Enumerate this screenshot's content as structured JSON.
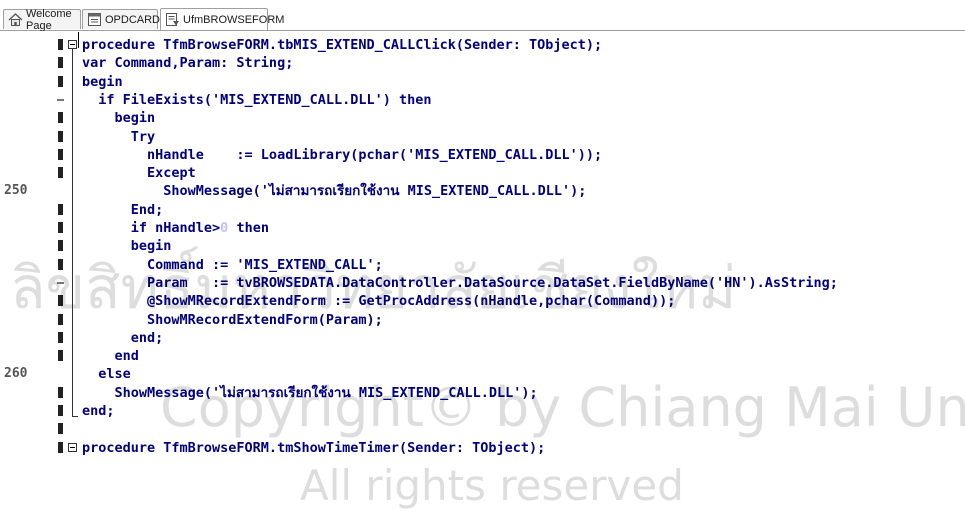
{
  "tabs": [
    {
      "label": "Welcome Page",
      "icon": "home-icon",
      "active": false
    },
    {
      "label": "OPDCARD",
      "icon": "form-icon",
      "active": false
    },
    {
      "label": "UfmBROWSEFORM",
      "icon": "unit-icon",
      "active": true
    }
  ],
  "editor": {
    "gutter": [
      {
        "kind": "mark"
      },
      {
        "kind": "mark"
      },
      {
        "kind": "mark"
      },
      {
        "kind": "dash"
      },
      {
        "kind": "mark"
      },
      {
        "kind": "mark"
      },
      {
        "kind": "mark"
      },
      {
        "kind": "mark"
      },
      {
        "kind": "number",
        "text": "250"
      },
      {
        "kind": "mark"
      },
      {
        "kind": "mark"
      },
      {
        "kind": "mark"
      },
      {
        "kind": "mark"
      },
      {
        "kind": "dash"
      },
      {
        "kind": "mark"
      },
      {
        "kind": "mark"
      },
      {
        "kind": "mark"
      },
      {
        "kind": "mark"
      },
      {
        "kind": "number",
        "text": "260"
      },
      {
        "kind": "mark"
      },
      {
        "kind": "mark"
      },
      {
        "kind": "mark"
      },
      {
        "kind": "mark"
      }
    ],
    "lines": [
      "procedure TfmBrowseFORM.tbMIS_EXTEND_CALLClick(Sender: TObject);",
      "var Command,Param: String;",
      "begin",
      "  if FileExists('MIS_EXTEND_CALL.DLL') then",
      "    begin",
      "      Try",
      "        nHandle    := LoadLibrary(pchar('MIS_EXTEND_CALL.DLL'));",
      "        Except",
      "          ShowMessage('ไม่สามารถเรียกใช้งาน MIS_EXTEND_CALL.DLL');",
      "      End;",
      "      if nHandle>0 then",
      "      begin",
      "        Command := 'MIS_EXTEND_CALL';",
      "        Param   := tvBROWSEDATA.DataController.DataSource.DataSet.FieldByName('HN').AsString;",
      "        @ShowMRecordExtendForm := GetProcAddress(nHandle,pchar(Command));",
      "        ShowMRecordExtendForm(Param);",
      "      end;",
      "    end",
      "  else",
      "    ShowMessage('ไม่สามารถเรียกใช้งาน MIS_EXTEND_CALL.DLL');",
      "end;",
      "",
      "procedure TfmBrowseFORM.tmShowTimeTimer(Sender: TObject);"
    ]
  },
  "watermark": {
    "lines": [
      "ลิขสิทธิ์มหาวิทยาลัยเชียงใหม่",
      "Copyright© by Chiang Mai University",
      "All rights reserved"
    ]
  }
}
